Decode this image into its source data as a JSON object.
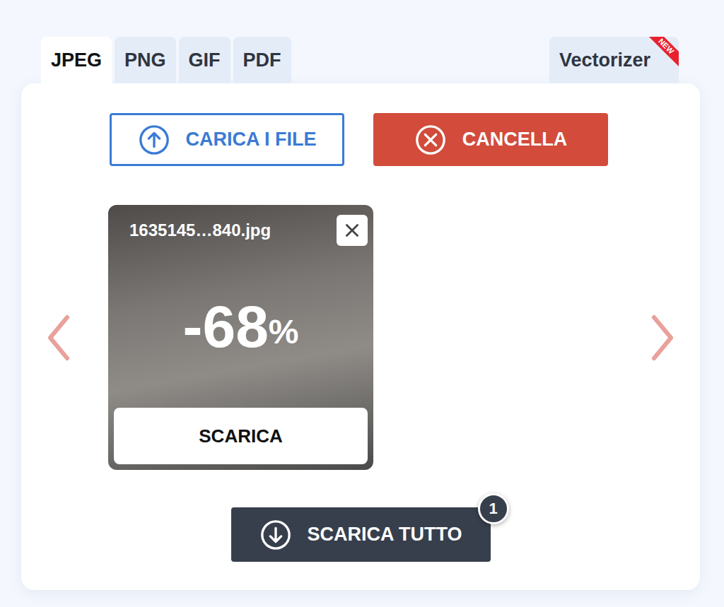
{
  "tabs": [
    {
      "label": "JPEG",
      "selected": true
    },
    {
      "label": "PNG",
      "selected": false
    },
    {
      "label": "GIF",
      "selected": false
    },
    {
      "label": "PDF",
      "selected": false
    }
  ],
  "extra_tab": {
    "label": "Vectorizer",
    "badge": "NEW",
    "selected": false
  },
  "actions": {
    "upload": "CARICA I FILE",
    "clear": "CANCELLA"
  },
  "files": [
    {
      "name": "1635145…840.jpg",
      "saving": "-68",
      "unit": "%",
      "download": "SCARICA"
    }
  ],
  "download_all": {
    "label": "SCARICA TUTTO",
    "count": "1"
  }
}
